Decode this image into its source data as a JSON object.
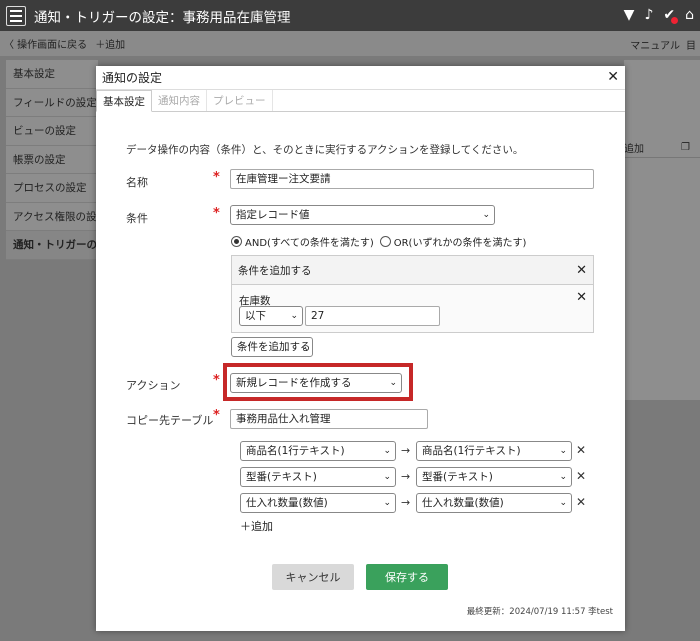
{
  "app": {
    "title": "通知・トリガーの設定：事務用品在庫管理"
  },
  "top_icons": [
    "shield-icon",
    "bell-icon",
    "check-icon",
    "home-icon"
  ],
  "subbar": {
    "back_label": "〈 操作画面に戻る",
    "add_label": "＋追加",
    "manual_label": "マニュアル",
    "print_label": "目"
  },
  "leftnav": {
    "items": [
      "基本設定",
      "フィールドの設定",
      "ビューの設定",
      "帳票の設定",
      "プロセスの設定",
      "アクセス権限の設定",
      "通知・トリガーの設定"
    ],
    "active_index": 6
  },
  "bgpanel": {
    "header_label": "追加"
  },
  "dialog": {
    "title": "通知の設定",
    "tabs": [
      "基本設定",
      "通知内容",
      "プレビュー"
    ],
    "intro": "データ操作の内容（条件）と、そのときに実行するアクションを登録してください。",
    "name_label": "名称",
    "name_value": "在庫管理ー注文要請",
    "condition_label": "条件",
    "condition_select": "指定レコード値",
    "radio_and": "AND(すべての条件を満たす)",
    "radio_or": "OR(いずれかの条件を満たす)",
    "add_condition_header": "条件を追加する",
    "condition_field": "在庫数",
    "condition_operator": "以下",
    "condition_value": "27",
    "add_condition_select": "条件を追加する",
    "action_label": "アクション",
    "action_select": "新規レコードを作成する",
    "copy_table_label": "コピー先テーブル",
    "copy_table_value": "事務用品仕入れ管理",
    "mappings": [
      {
        "source": "商品名(1行テキスト)",
        "target": "商品名(1行テキスト)"
      },
      {
        "source": "型番(テキスト)",
        "target": "型番(テキスト)"
      },
      {
        "source": "仕入れ数量(数値)",
        "target": "仕入れ数量(数値)"
      }
    ],
    "add_mapping": "＋追加",
    "cancel_label": "キャンセル",
    "save_label": "保存する",
    "last_update": "最終更新：2024/07/19 11:57 李test"
  },
  "colors": {
    "topbar": "#3c3c3c",
    "save_button": "#3aa15c",
    "highlight": "#c62828",
    "required": "#dd2222"
  }
}
